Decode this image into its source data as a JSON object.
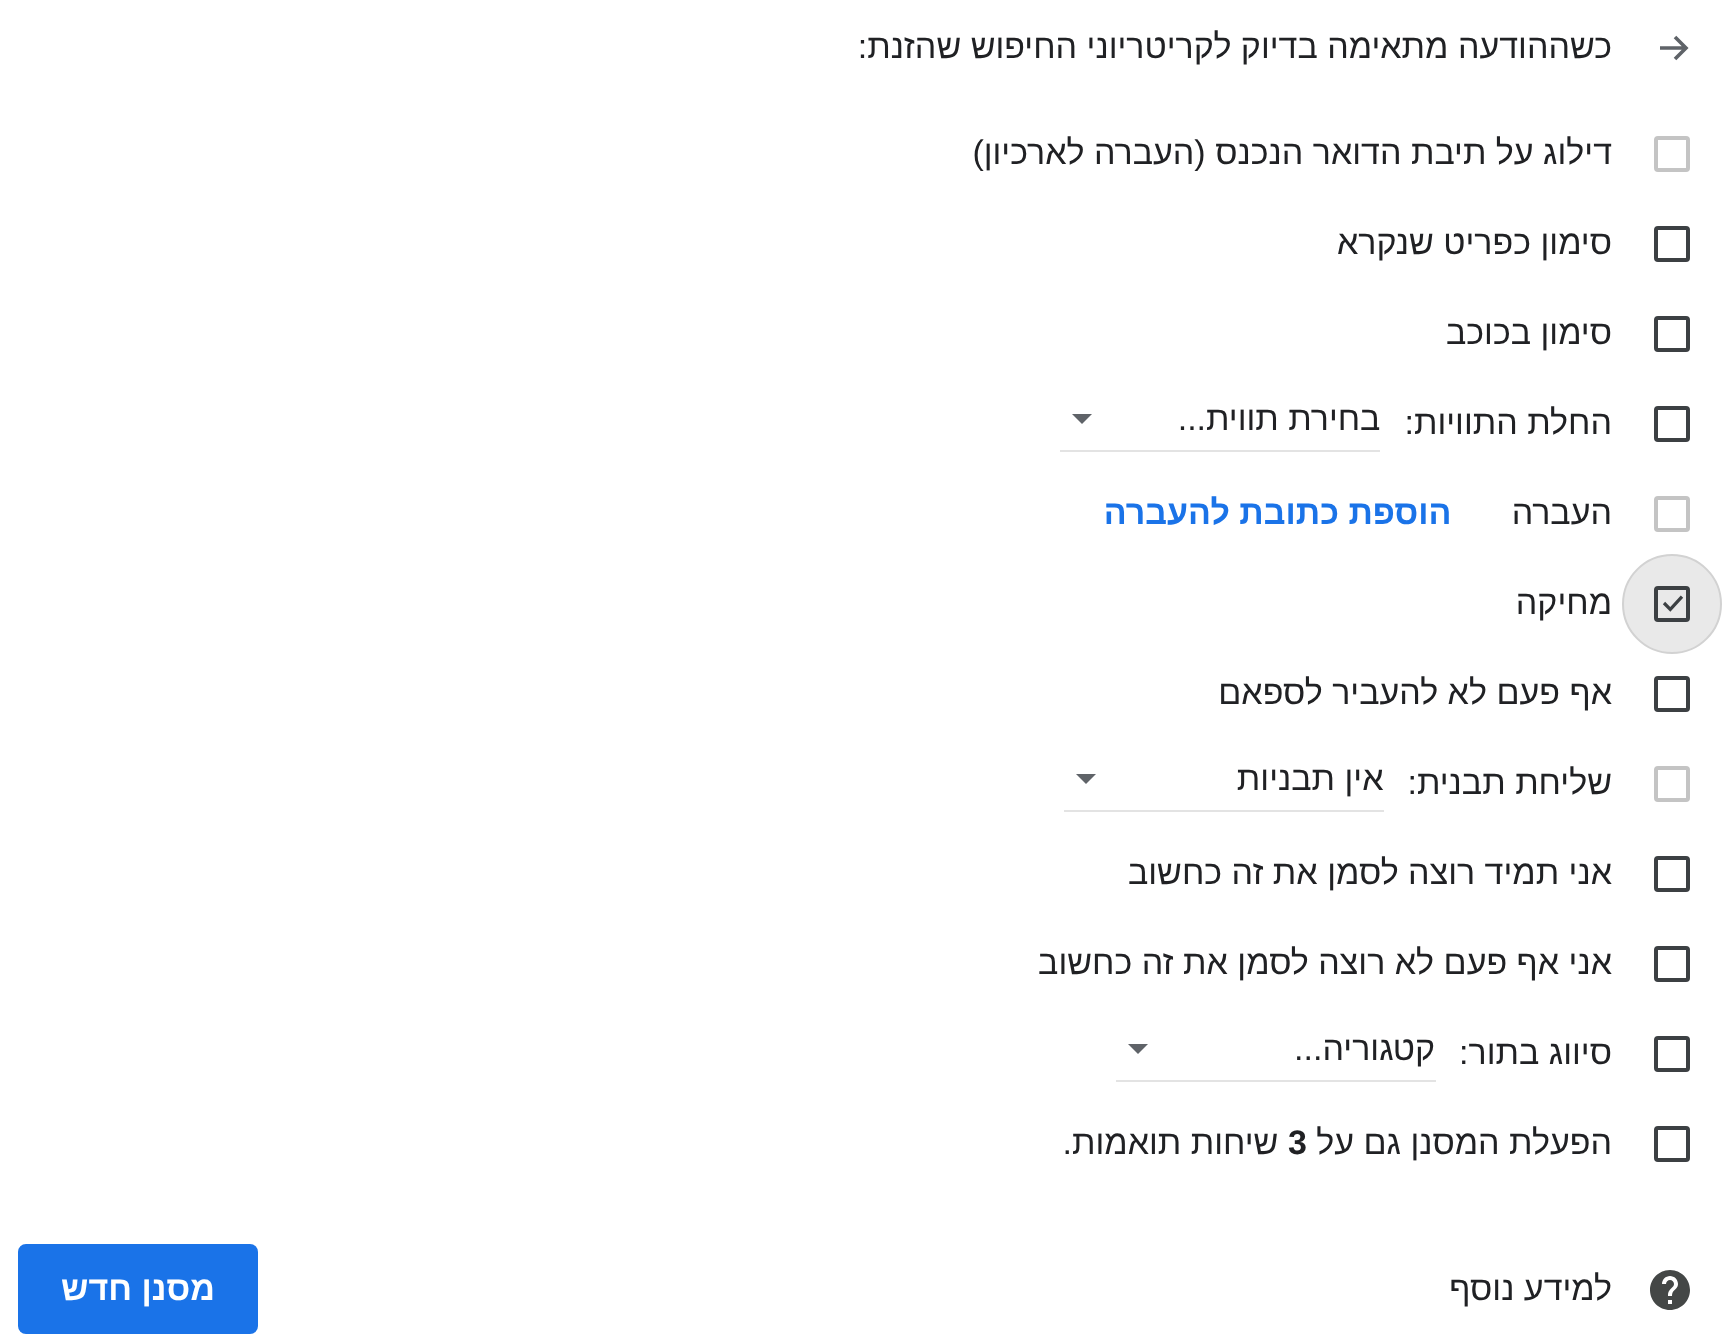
{
  "header": {
    "text": "כשההודעה מתאימה בדיוק לקריטריוני החיפוש שהזנת:"
  },
  "actions": [
    {
      "kind": "checkbox",
      "label": "דילוג על תיבת הדואר הנכנס (העברה לארכיון)",
      "checked": false,
      "disabled": true,
      "focused": false
    },
    {
      "kind": "checkbox",
      "label": "סימון כפריט שנקרא",
      "checked": false,
      "disabled": false,
      "focused": false
    },
    {
      "kind": "checkbox",
      "label": "סימון בכוכב",
      "checked": false,
      "disabled": false,
      "focused": false
    },
    {
      "kind": "select",
      "label": "החלת התוויות:",
      "value": "בחירת תווית...",
      "checked": false,
      "disabled": false,
      "focused": false
    },
    {
      "kind": "link",
      "label": "העברה",
      "link": "הוספת כתובת להעברה",
      "checked": false,
      "disabled": true,
      "focused": false
    },
    {
      "kind": "checkbox",
      "label": "מחיקה",
      "checked": true,
      "disabled": false,
      "focused": true
    },
    {
      "kind": "checkbox",
      "label": "אף פעם לא להעביר לספאם",
      "checked": false,
      "disabled": false,
      "focused": false
    },
    {
      "kind": "select",
      "label": "שליחת תבנית:",
      "value": "אין תבניות",
      "checked": false,
      "disabled": true,
      "focused": false
    },
    {
      "kind": "checkbox",
      "label": "אני תמיד רוצה לסמן את זה כחשוב",
      "checked": false,
      "disabled": false,
      "focused": false
    },
    {
      "kind": "checkbox",
      "label": "אני אף פעם לא רוצה לסמן את זה כחשוב",
      "checked": false,
      "disabled": false,
      "focused": false
    },
    {
      "kind": "select",
      "label": "סיווג בתור:",
      "value": "קטגוריה...",
      "checked": false,
      "disabled": false,
      "focused": false
    },
    {
      "kind": "checkbox",
      "label": "הפעלת המסנן גם על **3** שיחות תואמות.",
      "checked": false,
      "disabled": false,
      "focused": false
    }
  ],
  "help": {
    "text": "למידע נוסף"
  },
  "button": {
    "label": "מסנן חדש"
  }
}
